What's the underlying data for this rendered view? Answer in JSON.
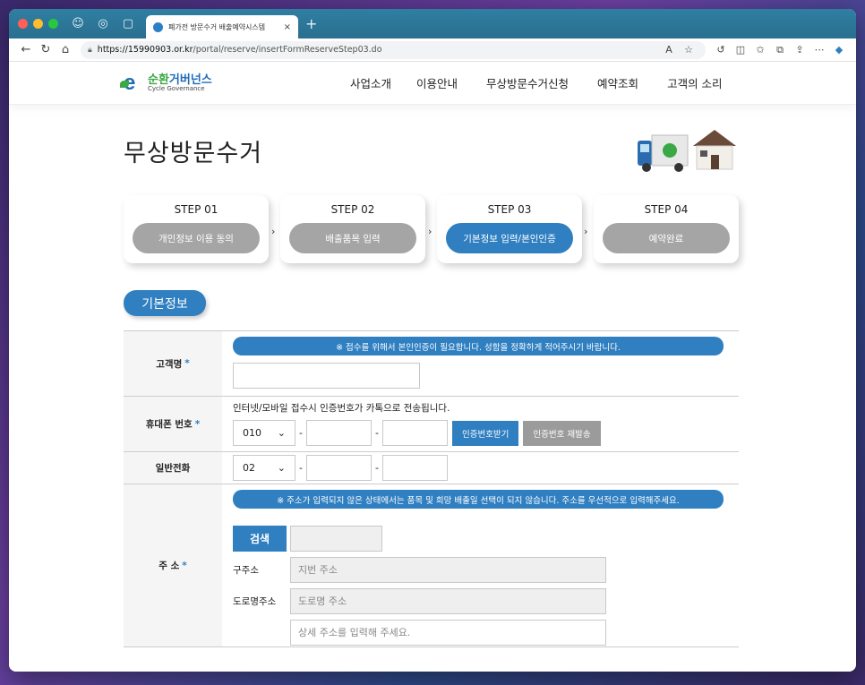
{
  "browser": {
    "tab_title": "폐가전 방문수거 배출예약시스템",
    "url_host": "https://15990903.or.kr",
    "url_path": "/portal/reserve/insertFormReserveStep03.do",
    "new_tab": "+",
    "tab_close": "×"
  },
  "site": {
    "logo_ko_a": "순환",
    "logo_ko_b": "거버넌스",
    "logo_en": "Cycle Governance",
    "nav": [
      "사업소개",
      "이용안내",
      "무상방문수거신청",
      "예약조회",
      "고객의 소리"
    ]
  },
  "page": {
    "title": "무상방문수거",
    "section_label": "기본정보"
  },
  "steps": [
    {
      "label": "STEP 01",
      "pill": "개인정보 이용 동의",
      "active": false
    },
    {
      "label": "STEP 02",
      "pill": "배출품목 입력",
      "active": false
    },
    {
      "label": "STEP 03",
      "pill": "기본정보 입력/본인인증",
      "active": true
    },
    {
      "label": "STEP 04",
      "pill": "예약완료",
      "active": false
    }
  ],
  "form": {
    "name": {
      "label": "고객명",
      "notice": "※ 접수를 위해서 본인인증이 필요합니다. 성함을 정확하게 적어주시기 바랍니다.",
      "value": ""
    },
    "mobile": {
      "label": "휴대폰 번호",
      "help": "인터넷/모바일 접수시 인증번호가 카톡으로 전송됩니다.",
      "prefix": "010",
      "verify_btn": "인증번호받기",
      "resend_btn": "인증번호 재발송"
    },
    "phone": {
      "label": "일반전화",
      "prefix": "02"
    },
    "address": {
      "label": "주 소",
      "notice": "※ 주소가 입력되지 않은 상태에서는 품목 및 희망 배출일 선택이 되지 않습니다. 주소를 우선적으로 입력해주세요.",
      "search_btn": "검색",
      "old_label": "구주소",
      "old_placeholder": "지번 주소",
      "road_label": "도로명주소",
      "road_placeholder": "도로명 주소",
      "detail_placeholder": "상세 주소를 입력해 주세요."
    },
    "required_mark": "*",
    "dash": "-"
  },
  "colors": {
    "primary": "#2f7fc1",
    "step_inactive": "#a5a5a5",
    "logo_green": "#3aa845"
  }
}
